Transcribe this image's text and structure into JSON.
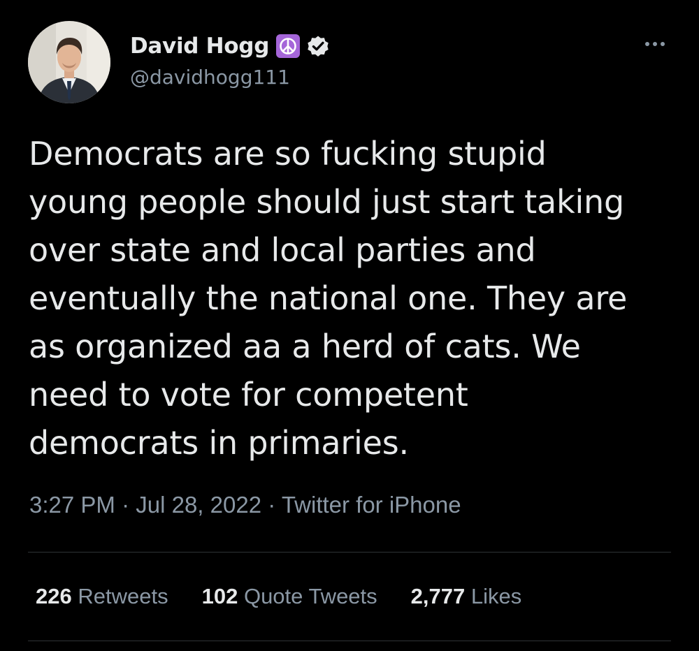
{
  "author": {
    "display_name": "David Hogg",
    "handle": "@davidhogg111",
    "emoji_icon": "peace-symbol-icon",
    "verified_icon": "verified-badge-icon"
  },
  "tweet": {
    "lines": [
      "Democrats are so fucking stupid",
      "young people should just start taking",
      "over state and local parties and",
      "eventually the national one. They are",
      "as organized aa a herd of cats. We",
      "need to vote for competent",
      "democrats in primaries."
    ],
    "time": "3:27 PM",
    "date": "Jul 28, 2022",
    "source": "Twitter for iPhone",
    "separator": "·"
  },
  "stats": {
    "retweets_count": "226",
    "retweets_label": "Retweets",
    "quotes_count": "102",
    "quotes_label": "Quote Tweets",
    "likes_count": "2,777",
    "likes_label": "Likes"
  },
  "colors": {
    "background": "#000000",
    "primary_text": "#e7e9ea",
    "secondary_text": "#8b98a5",
    "divider": "#2f3336",
    "emoji_purple": "#a566d9"
  }
}
